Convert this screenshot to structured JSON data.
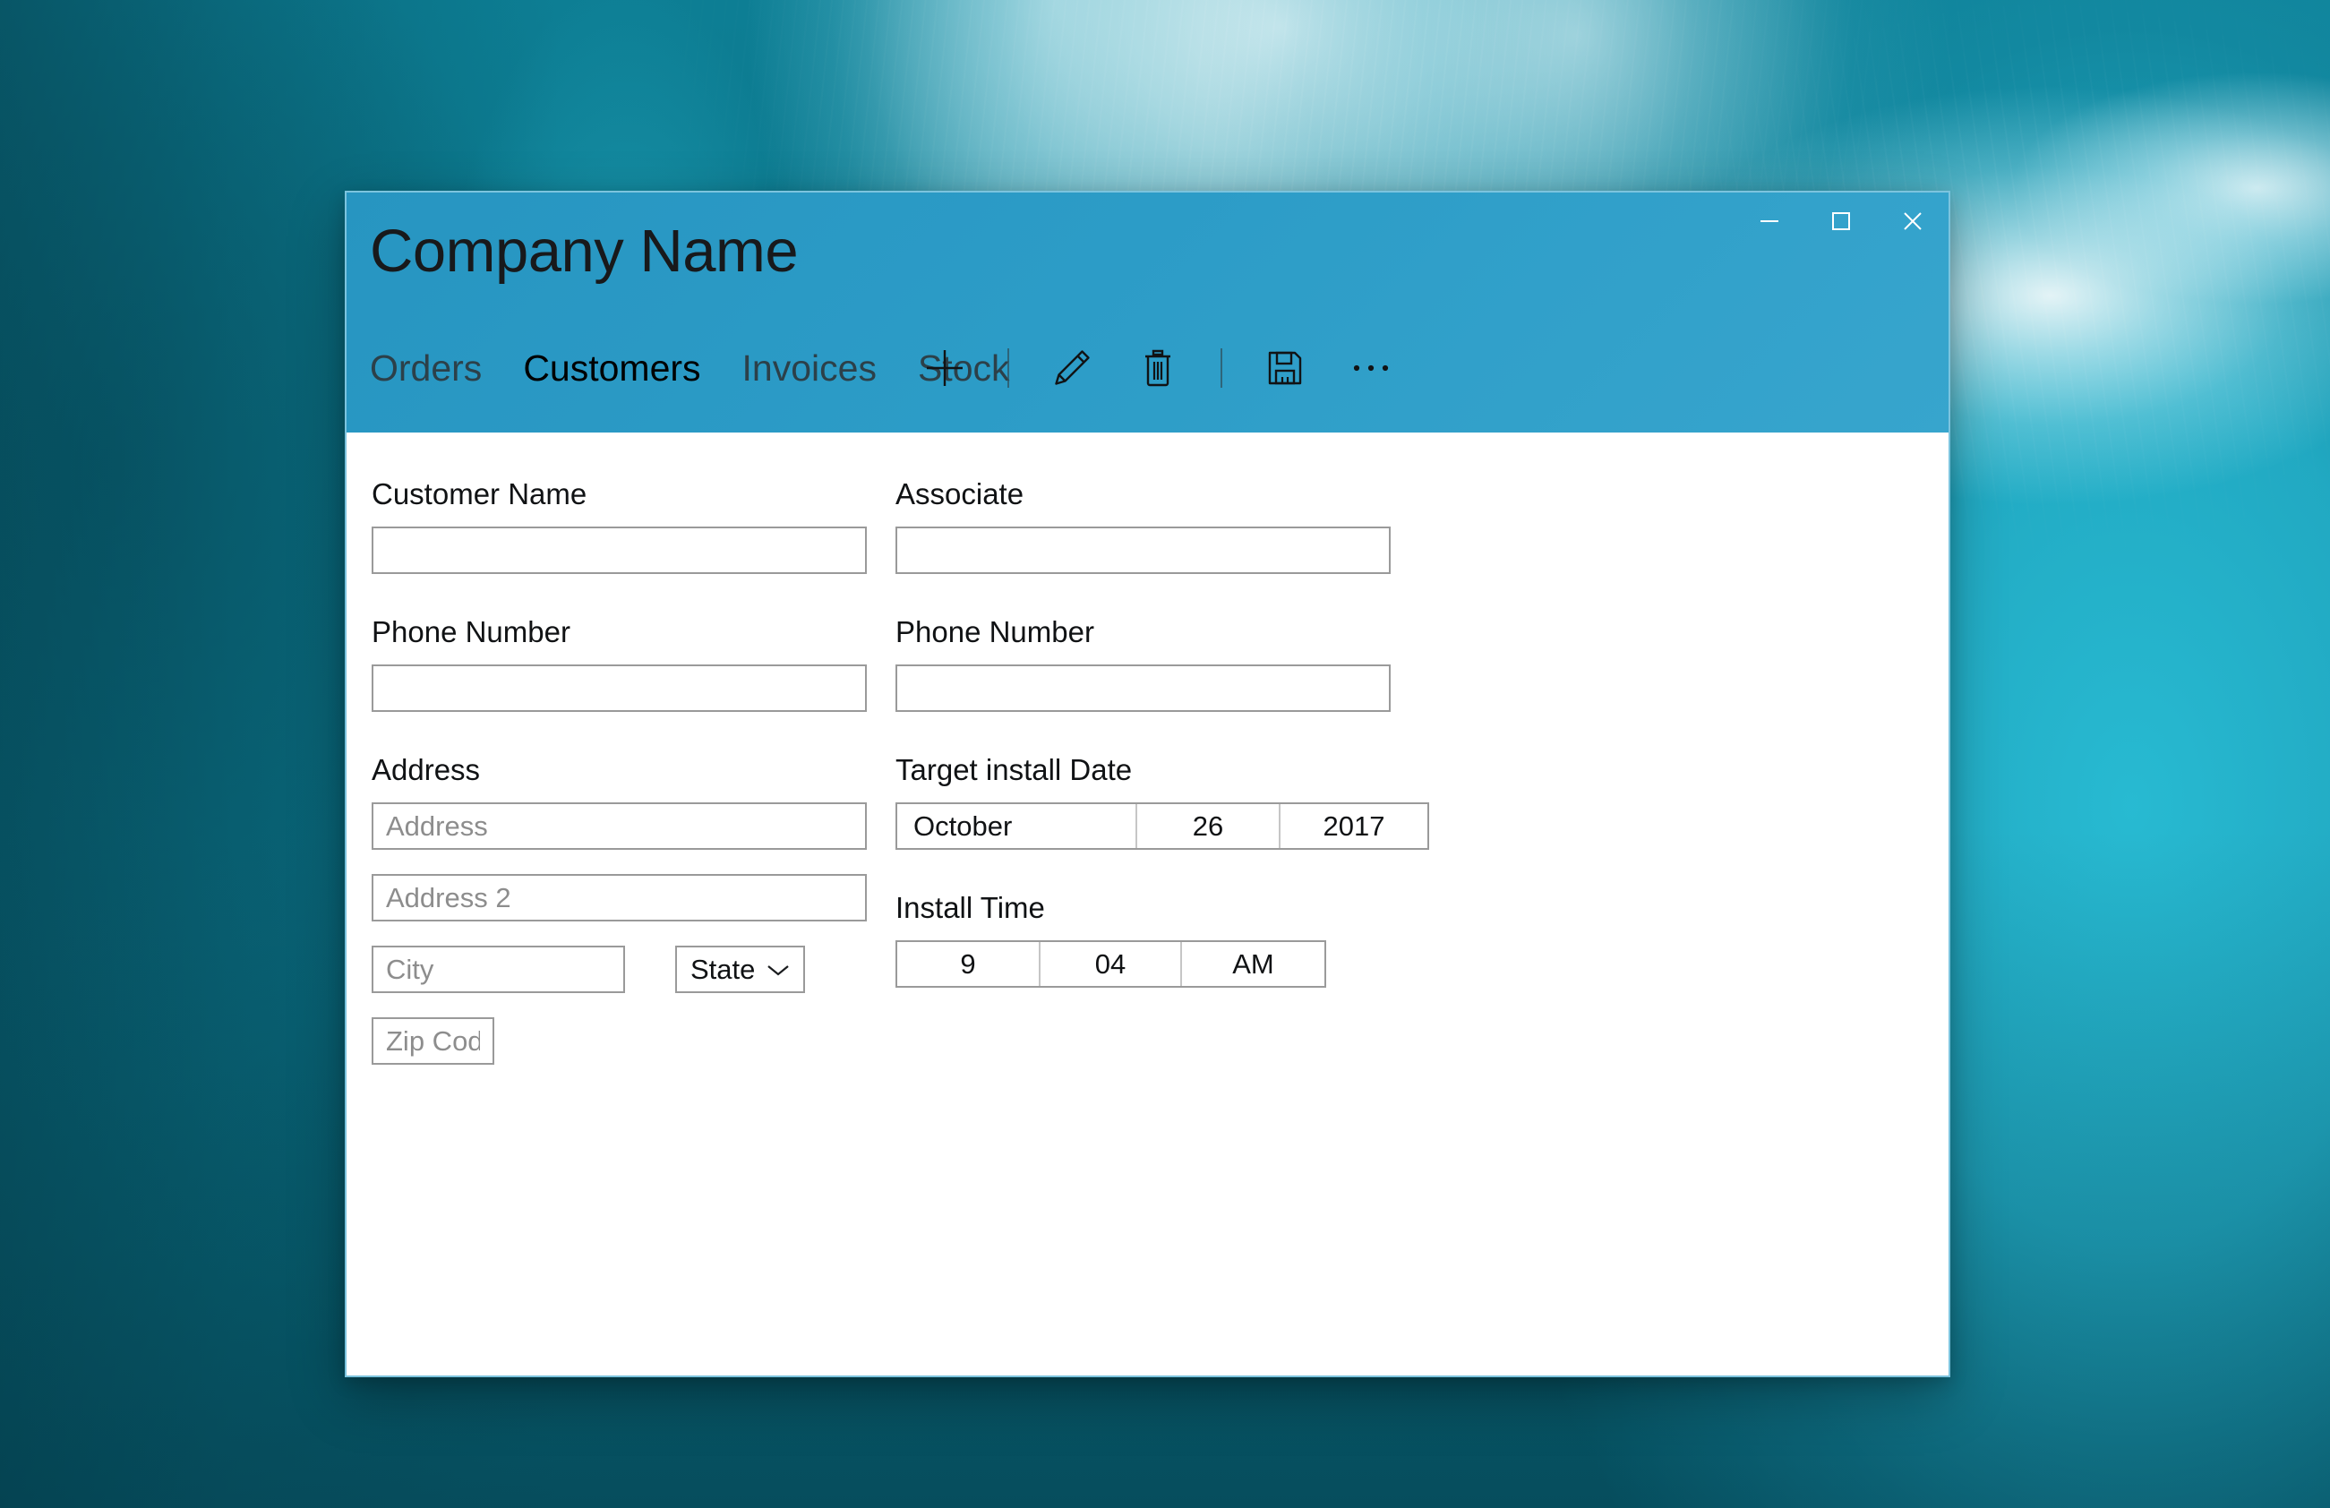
{
  "window": {
    "title": "Company Name",
    "controls": {
      "minimize": "minimize",
      "maximize": "maximize",
      "close": "close"
    }
  },
  "nav": {
    "tabs": [
      {
        "label": "Orders",
        "active": false
      },
      {
        "label": "Customers",
        "active": true
      },
      {
        "label": "Invoices",
        "active": false
      },
      {
        "label": "Stock",
        "active": false
      }
    ]
  },
  "toolbar": {
    "items": [
      {
        "icon": "plus-icon",
        "label": "Add"
      },
      {
        "icon": "separator",
        "label": ""
      },
      {
        "icon": "pencil-icon",
        "label": "Edit"
      },
      {
        "icon": "trash-icon",
        "label": "Delete"
      },
      {
        "icon": "separator",
        "label": ""
      },
      {
        "icon": "save-icon",
        "label": "Save"
      },
      {
        "icon": "ellipsis-icon",
        "label": "More"
      }
    ]
  },
  "form": {
    "left": {
      "customer_name": {
        "label": "Customer Name",
        "value": "",
        "placeholder": ""
      },
      "phone_number": {
        "label": "Phone Number",
        "value": "",
        "placeholder": ""
      },
      "address": {
        "label": "Address",
        "line1_placeholder": "Address",
        "line1_value": "",
        "line2_placeholder": "Address 2",
        "line2_value": "",
        "city_placeholder": "City",
        "city_value": "",
        "state_value": "State",
        "zip_placeholder": "Zip Code",
        "zip_value": ""
      }
    },
    "right": {
      "associate": {
        "label": "Associate",
        "value": "",
        "placeholder": ""
      },
      "phone_number": {
        "label": "Phone Number",
        "value": "",
        "placeholder": ""
      },
      "target_install_date": {
        "label": "Target install Date",
        "month": "October",
        "day": "26",
        "year": "2017"
      },
      "install_time": {
        "label": "Install Time",
        "hour": "9",
        "minute": "04",
        "period": "AM"
      }
    }
  },
  "colors": {
    "header": "#2c9cc7",
    "header_border": "#7cc4de",
    "input_border": "#9a9a9a",
    "placeholder": "#8d8d8d",
    "text": "#101214",
    "tab_inactive": "#2c4049",
    "desktop_deep": "#0a6a7e"
  }
}
